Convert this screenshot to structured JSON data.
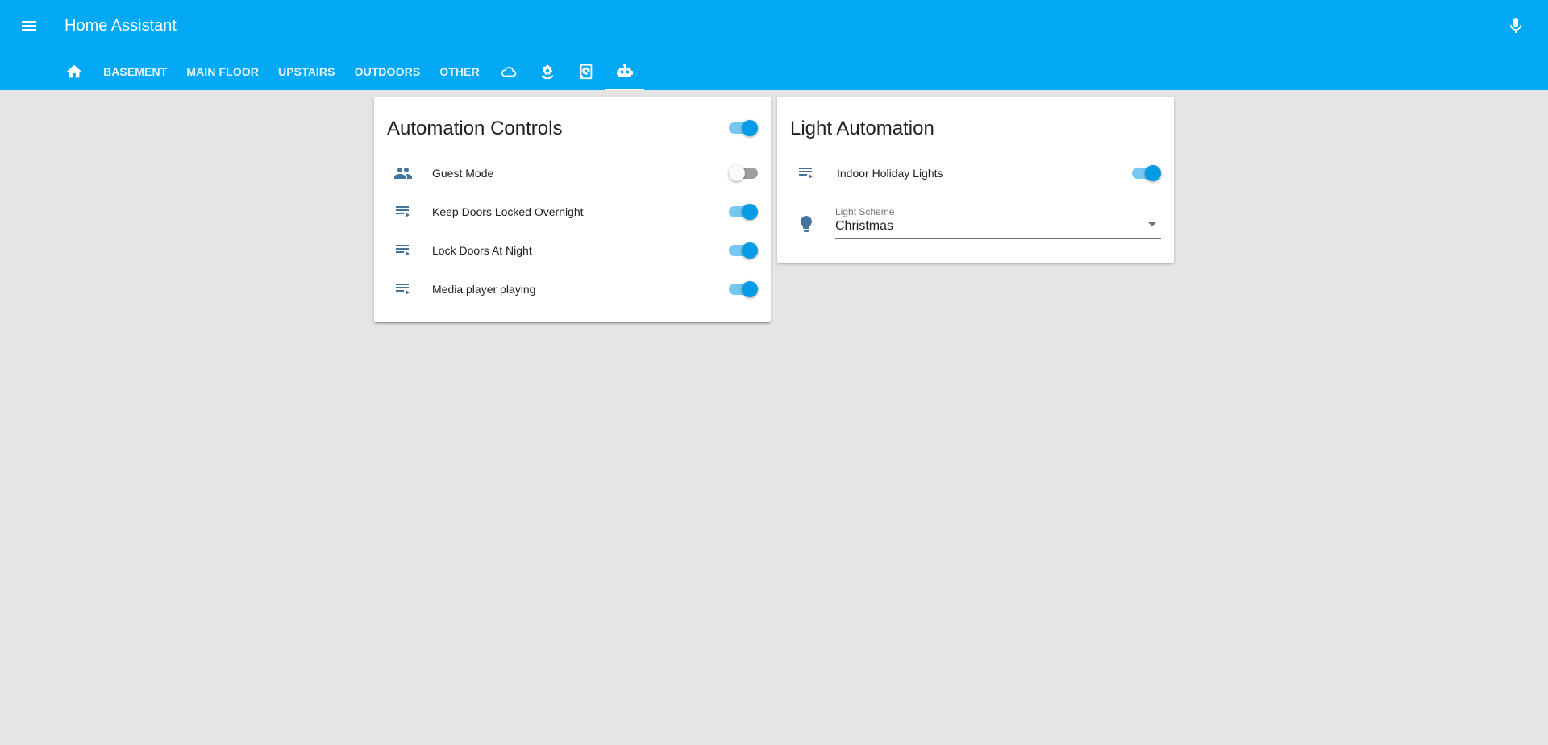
{
  "app": {
    "title": "Home Assistant"
  },
  "colors": {
    "header_bg": "#03a9f4",
    "accent": "#039be5",
    "icon": "#44739e",
    "page_bg": "#e5e5e5"
  },
  "header": {
    "menu_icon": "menu-icon",
    "mic_icon": "microphone-icon"
  },
  "tabs": [
    {
      "type": "icon",
      "icon": "home-icon",
      "label": ""
    },
    {
      "type": "text",
      "label": "BASEMENT"
    },
    {
      "type": "text",
      "label": "MAIN FLOOR"
    },
    {
      "type": "text",
      "label": "UPSTAIRS"
    },
    {
      "type": "text",
      "label": "OUTDOORS"
    },
    {
      "type": "text",
      "label": "OTHER"
    },
    {
      "type": "icon",
      "icon": "cloud-icon",
      "label": ""
    },
    {
      "type": "icon",
      "icon": "flower-icon",
      "label": ""
    },
    {
      "type": "icon",
      "icon": "harddisk-icon",
      "label": ""
    },
    {
      "type": "icon",
      "icon": "robot-icon",
      "label": "",
      "active": true
    }
  ],
  "automation_card": {
    "title": "Automation Controls",
    "header_toggle_on": true,
    "rows": [
      {
        "name": "Guest Mode",
        "icon": "account-multiple-icon",
        "on": false
      },
      {
        "name": "Keep Doors Locked Overnight",
        "icon": "playlist-play-icon",
        "on": true
      },
      {
        "name": "Lock Doors At Night",
        "icon": "playlist-play-icon",
        "on": true
      },
      {
        "name": "Media player playing",
        "icon": "playlist-play-icon",
        "on": true
      }
    ]
  },
  "light_card": {
    "title": "Light Automation",
    "rows": [
      {
        "name": "Indoor Holiday Lights",
        "icon": "playlist-play-icon",
        "on": true
      }
    ],
    "select": {
      "label": "Light Scheme",
      "value": "Christmas",
      "icon": "lightbulb-icon"
    }
  }
}
